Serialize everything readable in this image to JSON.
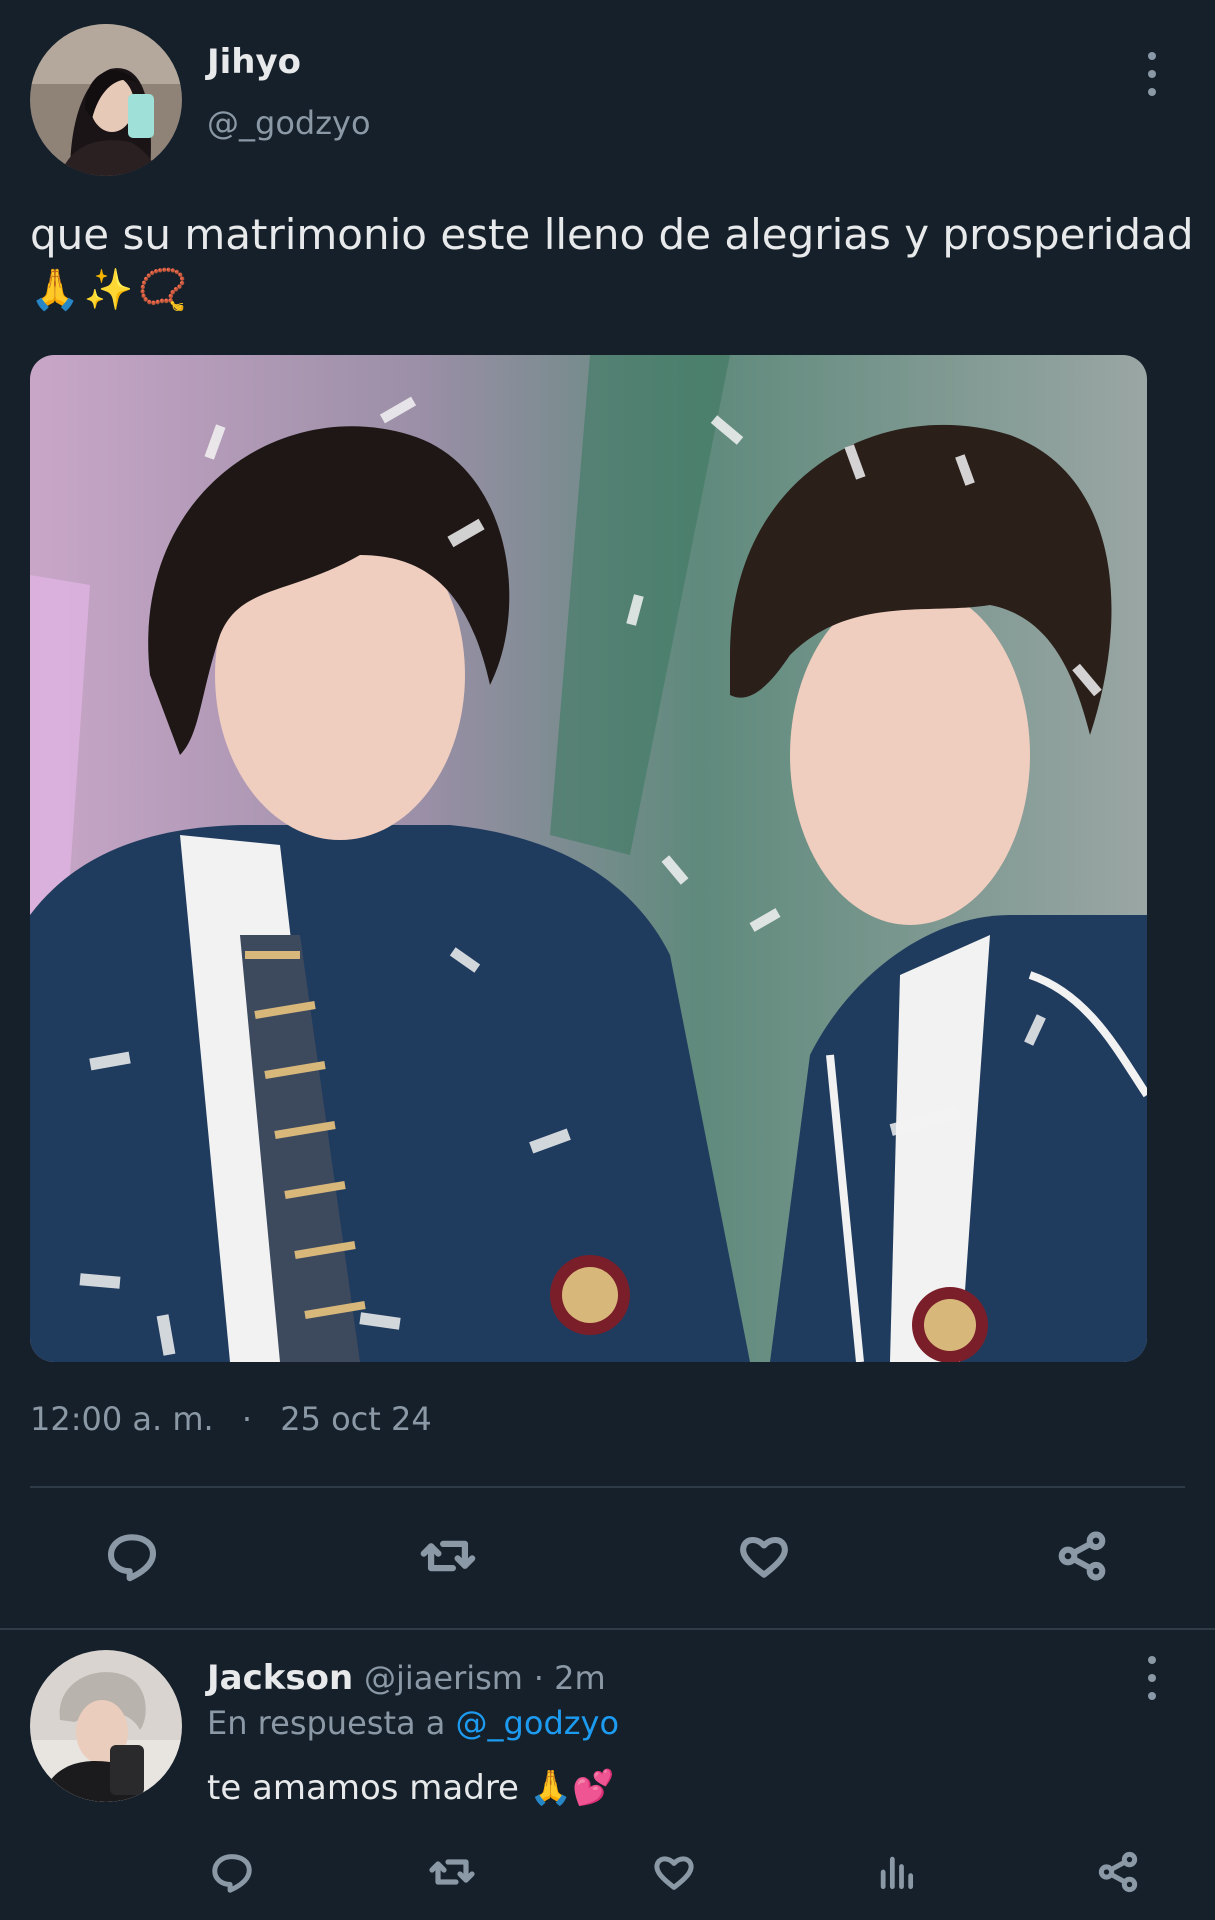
{
  "tweet": {
    "author_name": "Jihyo",
    "author_handle": "@_godzyo",
    "text_line1": "que su matrimonio este lleno de alegrias y prosperidad",
    "emojis": "🙏✨📿",
    "time": "12:00 a. m.",
    "separator": "·",
    "date": "25 oct 24",
    "actions": [
      "reply-icon",
      "retweet-icon",
      "like-icon",
      "share-icon"
    ]
  },
  "reply": {
    "author_name": "Jackson",
    "author_handle": "@jiaerism",
    "age": "· 2m",
    "replying_prefix": "En respuesta a",
    "replying_to": "@_godzyo",
    "text": "te amamos madre",
    "emojis": "🙏💕",
    "actions": [
      "reply-icon",
      "retweet-icon",
      "like-icon",
      "analytics-icon",
      "share-icon"
    ]
  },
  "colors": {
    "background": "#15202b",
    "muted_text": "#8b98a5",
    "link": "#1d9bf0",
    "divider": "#2f3b47"
  }
}
